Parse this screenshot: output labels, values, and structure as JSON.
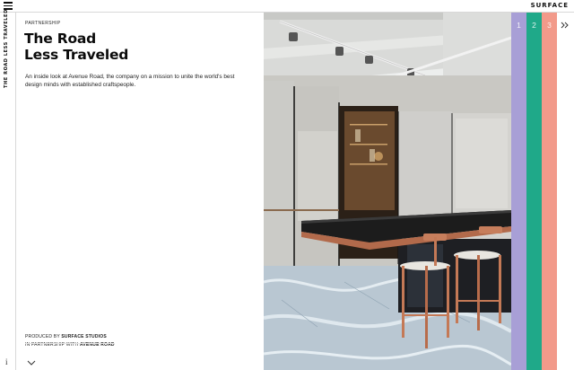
{
  "header": {
    "brand": "SURFACE",
    "menu_icon": "hamburger-menu-icon"
  },
  "rail": {
    "vertical_title": "THE ROAD LESS TRAVELED",
    "info_label": "i"
  },
  "article": {
    "eyebrow": "PARTNERSHIP",
    "title_line1": "The Road",
    "title_line2": "Less Traveled",
    "dek": "An inside look at Avenue Road, the company on a mission to unite the world's best design minds with established craftspeople.",
    "credit_prefix": "PRODUCED BY ",
    "credit_studio": "SURFACE STUDIOS",
    "partner_prefix": "IN PARTNERSHIP WITH ",
    "partner_name": "AVENUE ROAD",
    "scroll_icon": "chevron-down-icon"
  },
  "tabs": [
    {
      "label": "1",
      "color": "#a89fd6"
    },
    {
      "label": "2",
      "color": "#1fa989"
    },
    {
      "label": "3",
      "color": "#f29a8a"
    }
  ],
  "next_icon": "double-chevron-right-icon"
}
